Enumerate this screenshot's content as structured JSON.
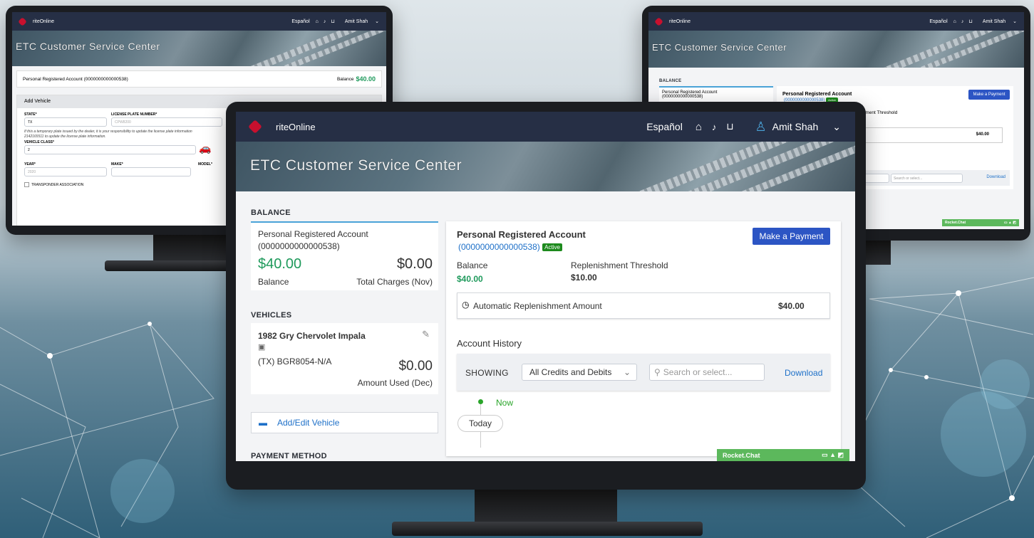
{
  "app": {
    "name": "riteOnline",
    "language_link": "Español",
    "user_name": "Amit Shah",
    "banner_title": "ETC Customer Service Center"
  },
  "colors": {
    "navbar": "#262f45",
    "accent_green": "#1f9a5c",
    "link_blue": "#1e70c8",
    "button_blue": "#2c55c4",
    "chat_green": "#5cb85c",
    "logo_red": "#c8102e"
  },
  "icons": [
    "home-icon",
    "bell-icon",
    "cart-icon",
    "user-avatar-icon",
    "chevron-down-icon"
  ],
  "left_monitor": {
    "account_line": "Personal Registered Account (0000000000000538)",
    "balance_label": "Balance",
    "balance_value": "$40.00",
    "panel_title": "Add Vehicle",
    "state_label": "STATE*",
    "state_value": "TX",
    "plate_label": "LICENSE PLATE NUMBER*",
    "plate_placeholder": "CPW8200",
    "temp_plate_note": "If this a temporary plate issued by the dealer, it is your responsibility to update the license plate information",
    "temp_plate_note2": "2142165511 to update the license plate information.",
    "vehicle_class_label": "VEHICLE CLASS*",
    "vehicle_class_value": "2",
    "year_label": "YEAR*",
    "year_placeholder": "2020",
    "make_label": "MAKE*",
    "model_label": "MODEL*",
    "transponder_label": "TRANSPONDER ASSOCIATION"
  },
  "right_monitor": {
    "balance_section": "BALANCE",
    "account_name": "Personal Registered Account",
    "account_number": "(0000000000000538)",
    "account_title": "Personal Registered Account",
    "account_number_link": "(0000000000000538)",
    "active_badge": "Active",
    "make_payment": "Make a Payment",
    "threshold_partial": "ishment Threshold",
    "amount_value": "$40.00",
    "filter_partial": "ts",
    "search_placeholder": "Search or select...",
    "download": "Download",
    "chat_label": "Rocket.Chat"
  },
  "center": {
    "balance_section": "BALANCE",
    "summary": {
      "account_name": "Personal Registered Account",
      "account_number": "(0000000000000538)",
      "balance_value": "$40.00",
      "balance_label": "Balance",
      "charges_value": "$0.00",
      "charges_label": "Total Charges (Nov)"
    },
    "vehicles_section": "VEHICLES",
    "vehicle": {
      "name": "1982 Gry Chervolet Impala",
      "plate": "(TX) BGR8054-N/A",
      "amount": "$0.00",
      "amount_label": "Amount Used (Dec)"
    },
    "add_edit_vehicle": "Add/Edit Vehicle",
    "payment_section": "PAYMENT METHOD",
    "detail": {
      "title": "Personal Registered Account",
      "account_number": "(0000000000000538)",
      "active_badge": "Active",
      "make_payment": "Make a Payment",
      "balance_label": "Balance",
      "balance_value": "$40.00",
      "threshold_label": "Replenishment Threshold",
      "threshold_value": "$10.00",
      "auto_replenish_label": "Automatic Replenishment Amount",
      "auto_replenish_value": "$40.00",
      "history_title": "Account History",
      "showing_label": "SHOWING",
      "filter_value": "All Credits and Debits",
      "search_placeholder": "Search or select...",
      "download": "Download",
      "timeline_now": "Now",
      "timeline_today": "Today"
    },
    "chat_label": "Rocket.Chat"
  }
}
